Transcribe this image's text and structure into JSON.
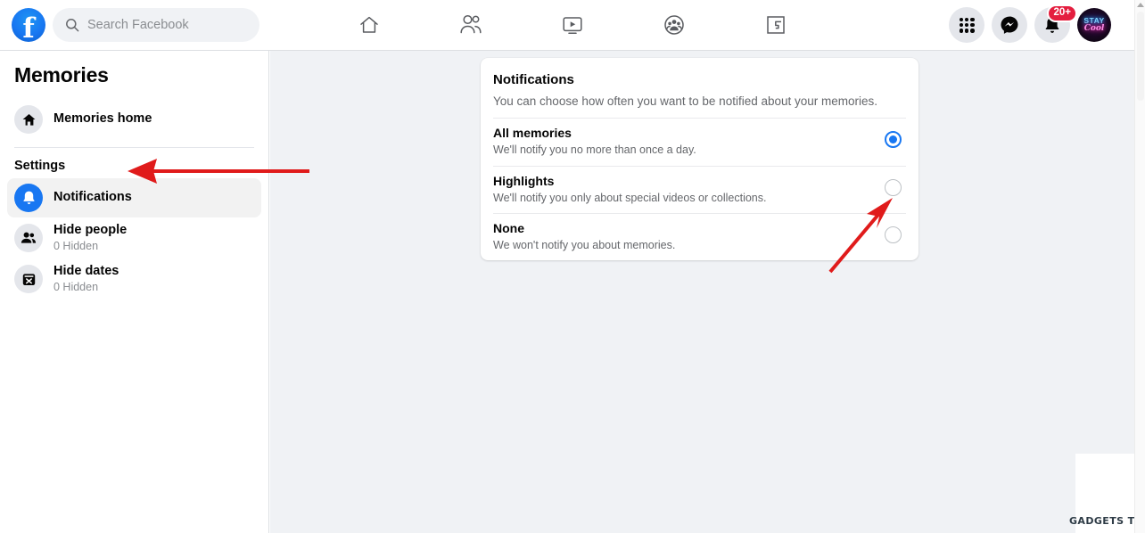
{
  "topbar": {
    "logo_alt": "Facebook",
    "logo_letter": "f",
    "search_placeholder": "Search Facebook",
    "search_value": "",
    "nav": [
      {
        "name": "home",
        "label": "Home"
      },
      {
        "name": "friends",
        "label": "Friends"
      },
      {
        "name": "watch",
        "label": "Watch"
      },
      {
        "name": "groups",
        "label": "Groups"
      },
      {
        "name": "gaming",
        "label": "Gaming"
      }
    ],
    "menu_label": "Menu",
    "messenger_label": "Messenger",
    "notifications_label": "Notifications",
    "notifications_badge": "20+",
    "account_label": "Account",
    "avatar_line1": "STAY",
    "avatar_line2": "Cool"
  },
  "sidebar": {
    "title": "Memories",
    "home_item": {
      "label": "Memories home",
      "icon": "home-icon"
    },
    "settings_heading": "Settings",
    "items": [
      {
        "label": "Notifications",
        "sub": "",
        "icon": "bell-icon",
        "active": true
      },
      {
        "label": "Hide people",
        "sub": "0 Hidden",
        "icon": "people-icon",
        "active": false
      },
      {
        "label": "Hide dates",
        "sub": "0 Hidden",
        "icon": "calendar-x-icon",
        "active": false
      }
    ]
  },
  "panel": {
    "title": "Notifications",
    "description": "You can choose how often you want to be notified about your memories.",
    "options": [
      {
        "label": "All memories",
        "sub": "We'll notify you no more than once a day.",
        "selected": true
      },
      {
        "label": "Highlights",
        "sub": "We'll notify you only about special videos or collections.",
        "selected": false
      },
      {
        "label": "None",
        "sub": "We won't notify you about memories.",
        "selected": false
      }
    ]
  },
  "annotations": {
    "arrow_color": "#e01b1b",
    "arrow_sidebar_target": "Notifications",
    "arrow_radio_target": "None"
  },
  "watermark": {
    "text": "GADGETS TO USE"
  },
  "colors": {
    "brand_blue": "#1877f2",
    "page_bg": "#f0f2f5",
    "card_bg": "#ffffff",
    "text_primary": "#050505",
    "text_secondary": "#65676b",
    "badge_red": "#e41e3f"
  }
}
